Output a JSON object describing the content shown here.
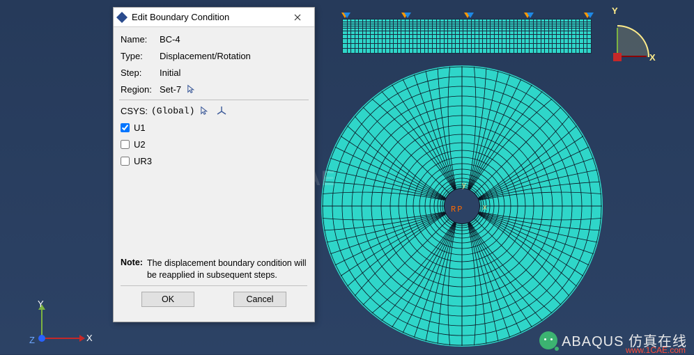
{
  "dialog": {
    "title": "Edit Boundary Condition",
    "fields": {
      "name_label": "Name:",
      "name_value": "BC-4",
      "type_label": "Type:",
      "type_value": "Displacement/Rotation",
      "step_label": "Step:",
      "step_value": "Initial",
      "region_label": "Region:",
      "region_value": "Set-7",
      "csys_label": "CSYS:",
      "csys_value": "(Global)"
    },
    "dofs": {
      "u1": {
        "label": "U1",
        "checked": true
      },
      "u2": {
        "label": "U2",
        "checked": false
      },
      "ur3": {
        "label": "UR3",
        "checked": false
      }
    },
    "note_label": "Note:",
    "note_text": "The displacement boundary condition will be reapplied in subsequent steps.",
    "ok": "OK",
    "cancel": "Cancel"
  },
  "viewport": {
    "triad": {
      "x": "X",
      "y": "Y",
      "z": "Z"
    },
    "rp": "RP",
    "local": {
      "x": "x",
      "y": "y"
    }
  },
  "branding": {
    "text": "ABAQUS 仿真在线",
    "url": "www.1CAE.com"
  },
  "watermark": "1CAE"
}
